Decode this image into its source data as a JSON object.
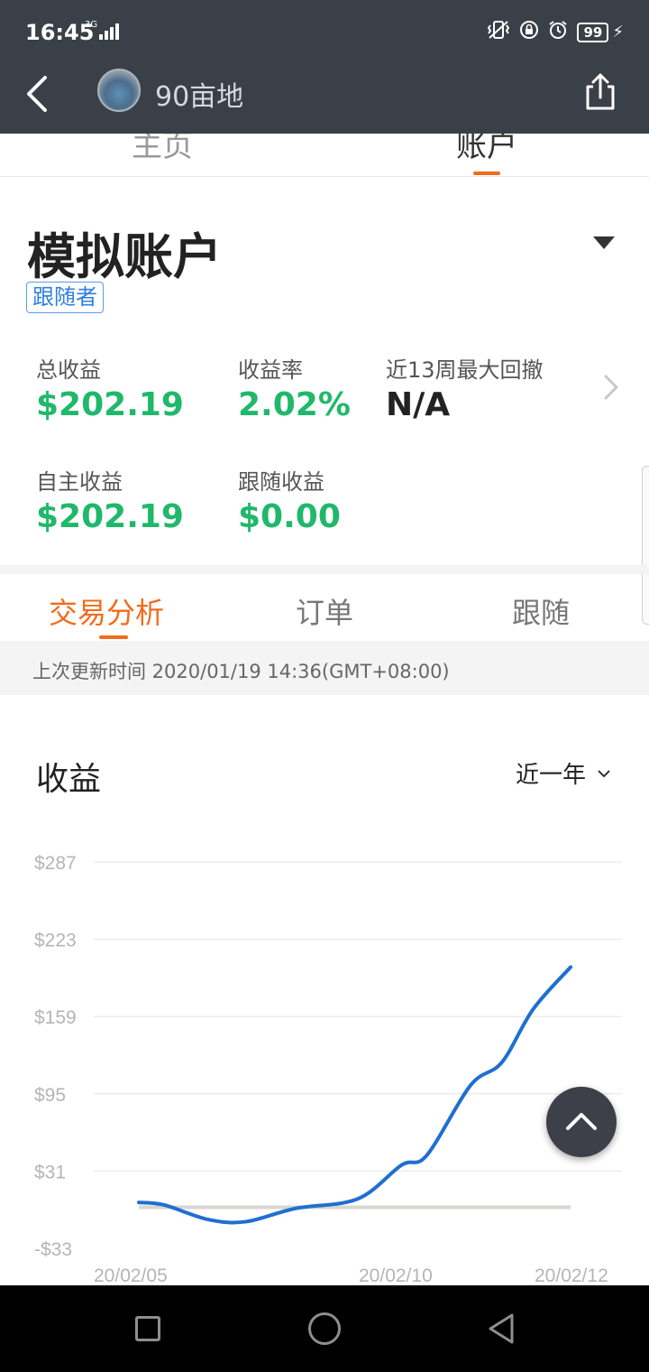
{
  "status_bar": {
    "time": "16:45",
    "network": "3G",
    "battery": "99",
    "icons": [
      "vibrate-icon",
      "screen-lock-icon",
      "alarm-icon",
      "battery-icon",
      "charging-icon"
    ]
  },
  "header": {
    "title": "90亩地",
    "back_icon": "chevron-left-icon",
    "share_icon": "share-icon"
  },
  "top_tabs": [
    {
      "label": "主页",
      "active": false
    },
    {
      "label": "账户",
      "active": true
    }
  ],
  "account": {
    "title": "模拟账户",
    "role_badge": "跟随者",
    "metrics": {
      "total_profit_label": "总收益",
      "total_profit": "$202.19",
      "return_rate_label": "收益率",
      "return_rate": "2.02%",
      "max_drawdown_label": "近13周最大回撤",
      "max_drawdown": "N/A",
      "self_profit_label": "自主收益",
      "self_profit": "$202.19",
      "follow_profit_label": "跟随收益",
      "follow_profit": "$0.00"
    }
  },
  "sub_tabs": [
    {
      "label": "交易分析",
      "active": true
    },
    {
      "label": "订单",
      "active": false
    },
    {
      "label": "跟随",
      "active": false
    }
  ],
  "update_time": "上次更新时间 2020/01/19 14:36(GMT+08:00)",
  "chart_section": {
    "title": "收益",
    "period": "近一年"
  },
  "colors": {
    "accent": "#f26b1d",
    "profit_green": "#20b86a",
    "line_blue": "#1f6fd1",
    "baseline_gray": "#d9d5d0",
    "dark_bar": "#3a4048"
  },
  "chart_data": {
    "type": "line",
    "title": "",
    "xlabel": "",
    "ylabel": "",
    "y_ticks": [
      "$287",
      "$223",
      "$159",
      "$95",
      "$31",
      "-$33"
    ],
    "y_tick_values": [
      287,
      223,
      159,
      95,
      31,
      -33
    ],
    "x_ticks": [
      "20/02/05",
      "20/02/10",
      "20/02/12"
    ],
    "x_tick_values": [
      0,
      5,
      7
    ],
    "ylim": [
      -33,
      287
    ],
    "grid": true,
    "legend": "none",
    "series": [
      {
        "x": [
          0,
          0.4,
          1.1,
          1.7,
          2.5,
          3.5,
          4.2,
          4.6,
          5.3,
          5.8,
          6.3,
          6.9
        ],
        "values": [
          5,
          3,
          -9,
          -11,
          0,
          8,
          36,
          44,
          102,
          121,
          165,
          200
        ],
        "color": "#1f6fd1"
      },
      {
        "x": [
          0,
          6.9
        ],
        "values": [
          1,
          1
        ],
        "color": "#d9d5d0"
      }
    ]
  }
}
